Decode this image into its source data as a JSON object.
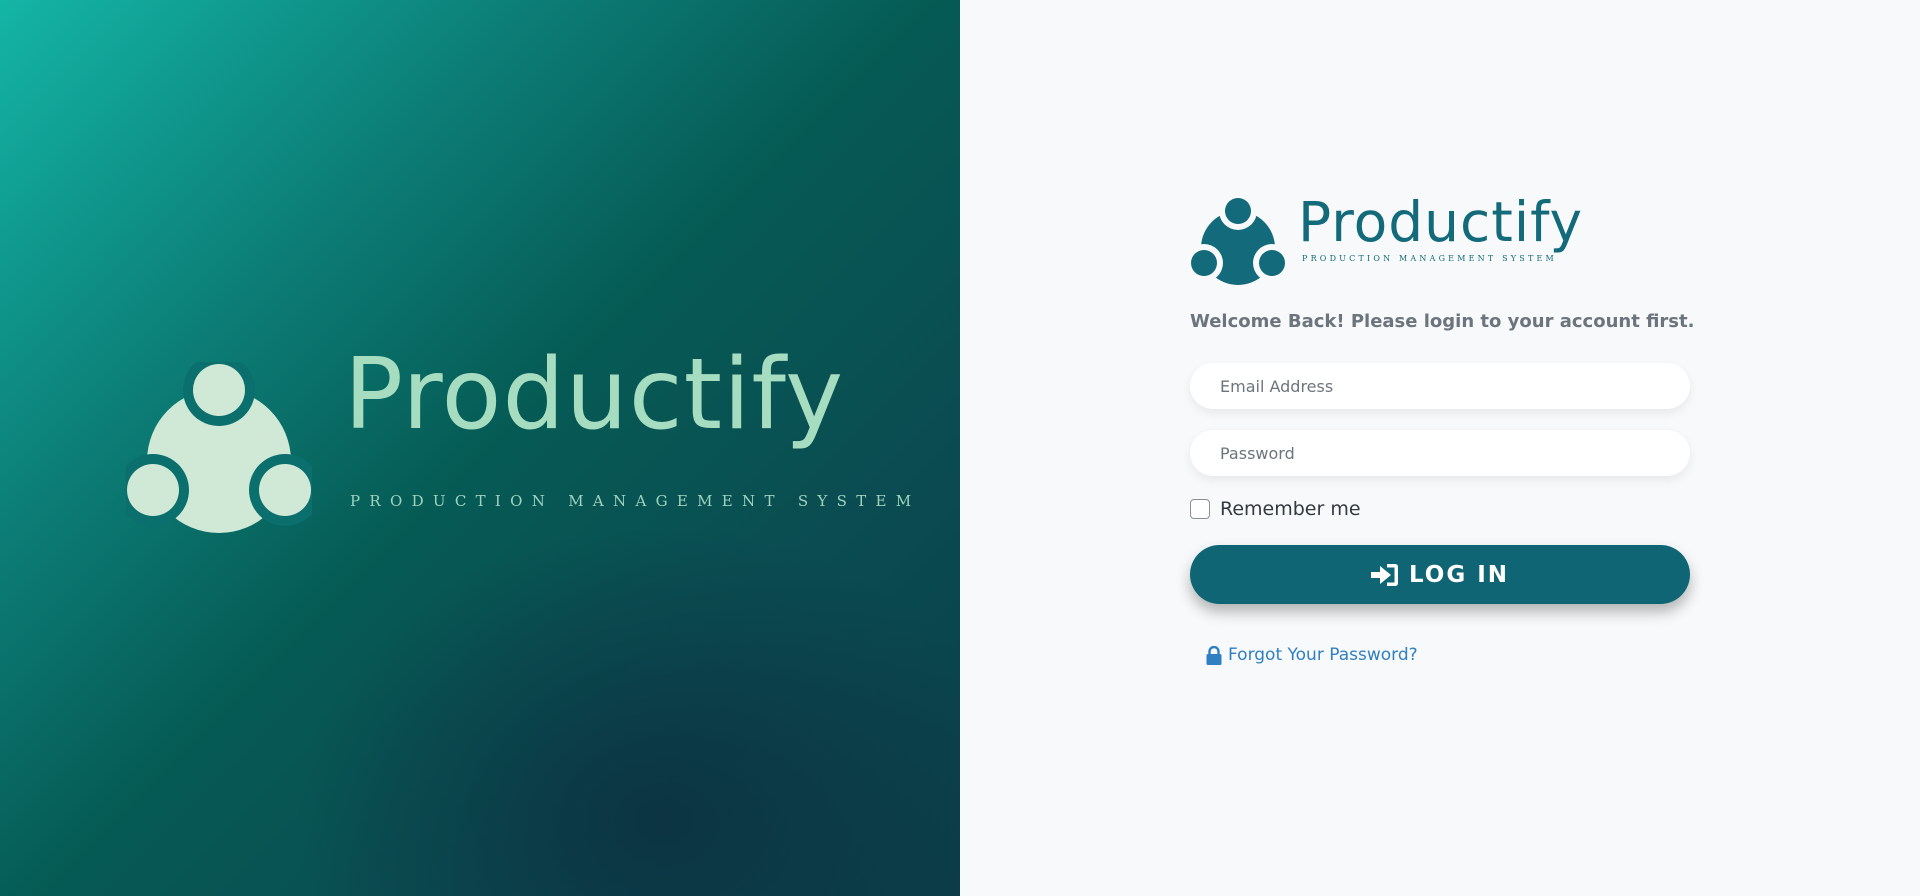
{
  "hero": {
    "wordmark": "Productify",
    "tagline": "PRODUCTION MANAGEMENT SYSTEM",
    "logo_icon": "team-logo-icon"
  },
  "brand": {
    "wordmark": "Productify",
    "tagline": "PRODUCTION MANAGEMENT SYSTEM",
    "logo_icon": "team-logo-icon"
  },
  "login": {
    "welcome_text": "Welcome Back! Please login to your account first.",
    "email_placeholder": "Email Address",
    "email_value": "",
    "password_placeholder": "Password",
    "password_value": "",
    "remember_label": "Remember me",
    "remember_checked": false,
    "submit_label": "LOG IN",
    "submit_icon": "sign-in-icon",
    "forgot_label": "Forgot Your Password?",
    "forgot_icon": "lock-icon"
  },
  "colors": {
    "brand_teal": "#106575",
    "hero_logo": "#a6dcc0",
    "link_blue": "#2f7fc2",
    "panel_bg": "#f7f9fa"
  }
}
